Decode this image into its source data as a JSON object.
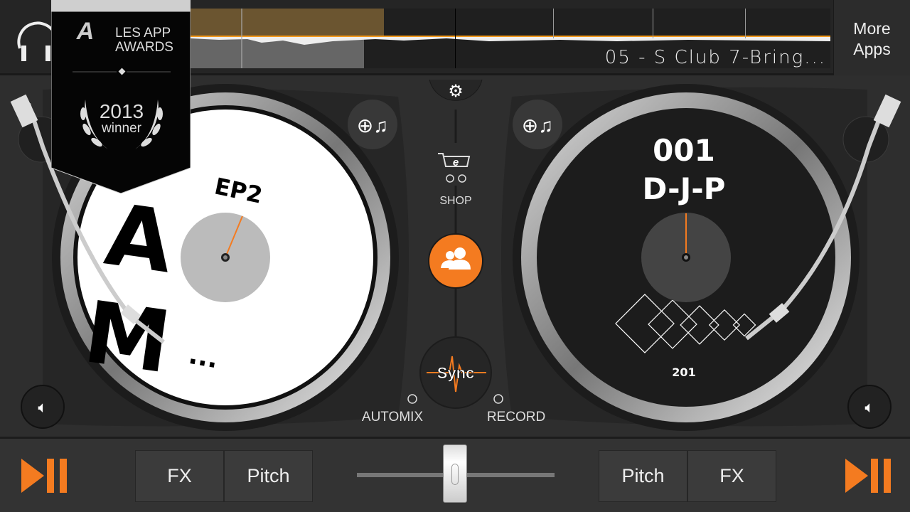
{
  "top": {
    "track_title": "05 - S Club 7-Bring...",
    "more_apps": "More Apps",
    "more_apps_line1": "More",
    "more_apps_line2": "Apps"
  },
  "award": {
    "line1": "LES APP",
    "line2": "AWARDS",
    "year": "2013",
    "label": "winner"
  },
  "deck_left": {
    "label_text": "EP2",
    "letters": [
      "A",
      "M"
    ],
    "dots": "..."
  },
  "deck_right": {
    "number": "001",
    "artist": "D-J-P",
    "bpm": "201"
  },
  "center": {
    "shop": "SHOP",
    "sync": "Sync",
    "automix": "AUTOMIX",
    "record": "RECORD"
  },
  "bottom": {
    "fx_left": "FX",
    "pitch_left": "Pitch",
    "pitch_right": "Pitch",
    "fx_right": "FX",
    "crossfader": 0.5
  },
  "colors": {
    "accent": "#f47b20",
    "background": "#2e2e2e"
  }
}
